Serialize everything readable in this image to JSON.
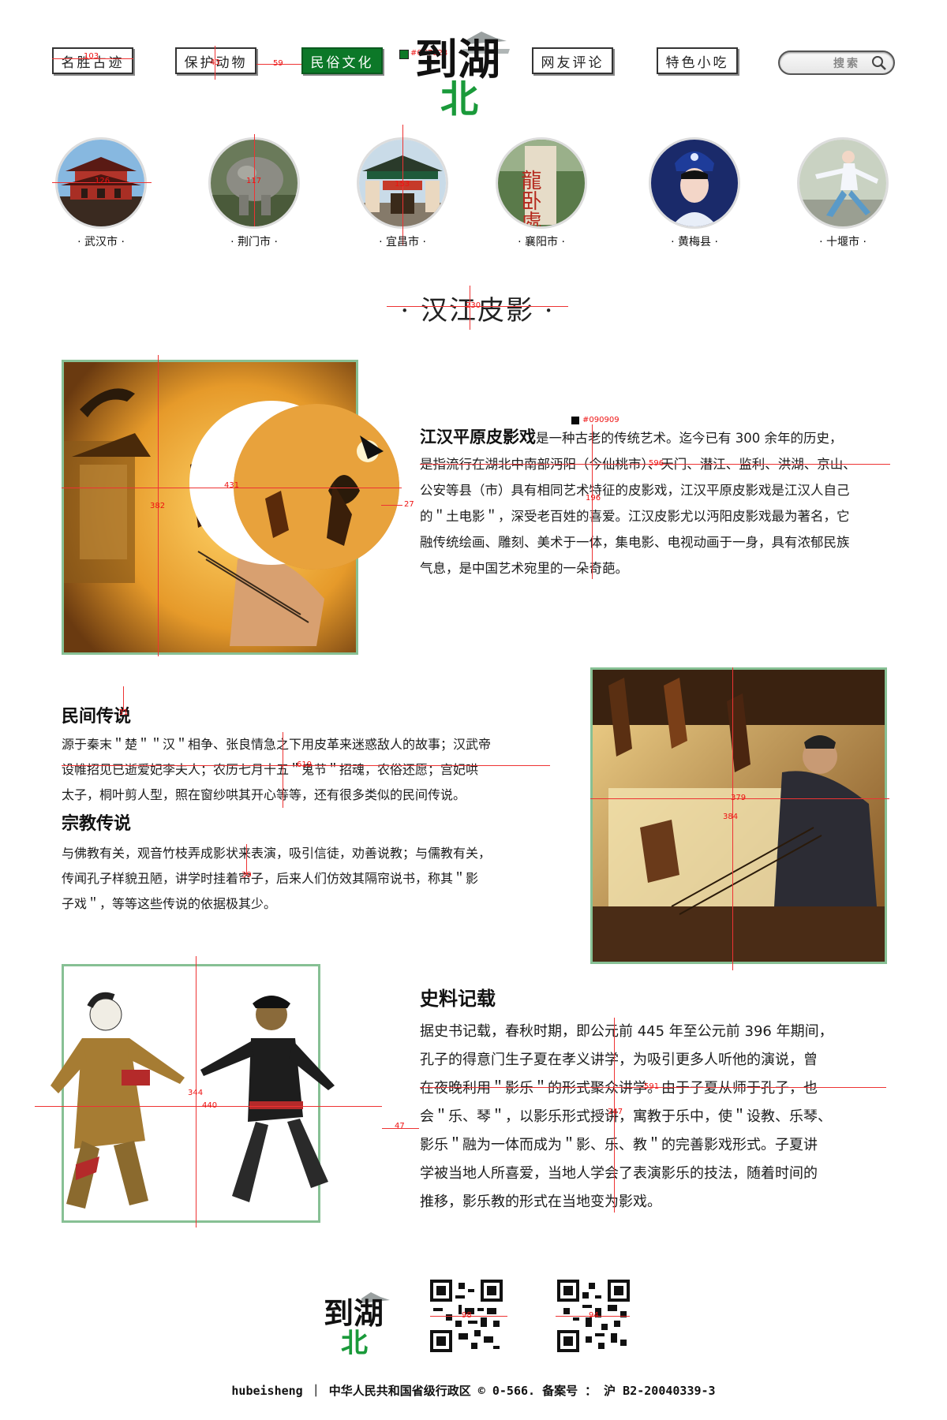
{
  "nav": {
    "items": [
      {
        "label": "名胜古迹",
        "active": false
      },
      {
        "label": "保护动物",
        "active": false
      },
      {
        "label": "民俗文化",
        "active": true
      },
      {
        "label": "网友评论",
        "active": false
      },
      {
        "label": "特色小吃",
        "active": false
      }
    ],
    "search_label": "搜索"
  },
  "logo": {
    "text_top": "到湖",
    "text_bottom": "北"
  },
  "colors": {
    "accent": "#0C7828",
    "text": "#090909",
    "frame": "#87c094"
  },
  "specs": {
    "accent_hex": "#0C7828",
    "text_hex": "#090909",
    "nav_width": "103",
    "nav_height": "43",
    "nav_gap": "59",
    "circle_1": "126",
    "circle_2": "117",
    "circle_3": "153",
    "title_width": "230",
    "img1_w": "431",
    "img1_h": "382",
    "img1_gap": "27",
    "para1_w": "596",
    "para1_h": "196",
    "h2_gap": "31",
    "para2_w": "619",
    "para3_h": "39",
    "img2_w": "379",
    "img2_h": "384",
    "img3_h": "344",
    "img3_w": "440",
    "img3_gap": "47",
    "para4_w": "591",
    "para4_h": "247",
    "qr1": "98",
    "qr2": "94"
  },
  "cities": [
    {
      "label": "· 武汉市 ·"
    },
    {
      "label": "· 荆门市 ·"
    },
    {
      "label": "· 宜昌市 ·"
    },
    {
      "label": "· 襄阳市 ·"
    },
    {
      "label": "· 黄梅县 ·"
    },
    {
      "label": "· 十堰市 ·"
    }
  ],
  "city_sign_text": "龍卧處",
  "section_title": "· 汉江皮影 ·",
  "intro": {
    "lead": "江汉平原皮影戏",
    "lines": [
      "是一种古老的传统艺术。迄今已有 300 余年的历史，",
      "是指流行在湖北中南部沔阳（今仙桃市）、天门、潜江、监利、洪湖、京山、",
      "公安等县（市）具有相同艺术特征的皮影戏，江汉平原皮影戏是江汉人自己",
      "的＂土电影＂，深受老百姓的喜爱。江汉皮影尤以沔阳皮影戏最为著名，它",
      "融传统绘画、雕刻、美术于一体，集电影、电视动画于一身，具有浓郁民族",
      "气息，是中国艺术宛里的一朵奇葩。"
    ]
  },
  "folk": {
    "heading": "民间传说",
    "lines": [
      "源于秦末＂楚＂＂汉＂相争、张良情急之下用皮革来迷惑敌人的故事；汉武帝",
      "设帷招见已逝爱妃李夫人；农历七月十五＂鬼节＂招魂，农俗还愿；宫妃哄",
      "太子，桐叶剪人型，照在窗纱哄其开心等等，还有很多类似的民间传说。"
    ]
  },
  "religion": {
    "heading": "宗教传说",
    "lines": [
      "与佛教有关，观音竹枝弄成影状来表演，吸引信徒，劝善说教；与儒教有关，",
      "传闻孔子样貌丑陋，讲学时挂着帘子，后来人们仿效其隔帘说书，称其＂影",
      "子戏＂，等等这些传说的依据极其少。"
    ]
  },
  "history": {
    "heading": "史料记载",
    "lines": [
      "据史书记载，春秋时期，即公元前 445 年至公元前 396 年期间，",
      "孔子的得意门生子夏在孝义讲学，为吸引更多人听他的演说，曾",
      "在夜晚利用＂影乐＂的形式聚众讲学。由于子夏从师于孔子，也",
      "会＂乐、琴＂，以影乐形式授讲，寓教于乐中，使＂设教、乐琴、",
      "影乐＂融为一体而成为＂影、乐、教＂的完善影戏形式。子夏讲",
      "学被当地人所喜爱，当地人学会了表演影乐的技法，随着时间的",
      "推移，影乐教的形式在当地变为影戏。"
    ]
  },
  "footer": {
    "text": "hubeisheng ｜ 中华人民共和国省级行政区 © 0-566. 备案号 ： 沪 B2-20040339-3"
  }
}
